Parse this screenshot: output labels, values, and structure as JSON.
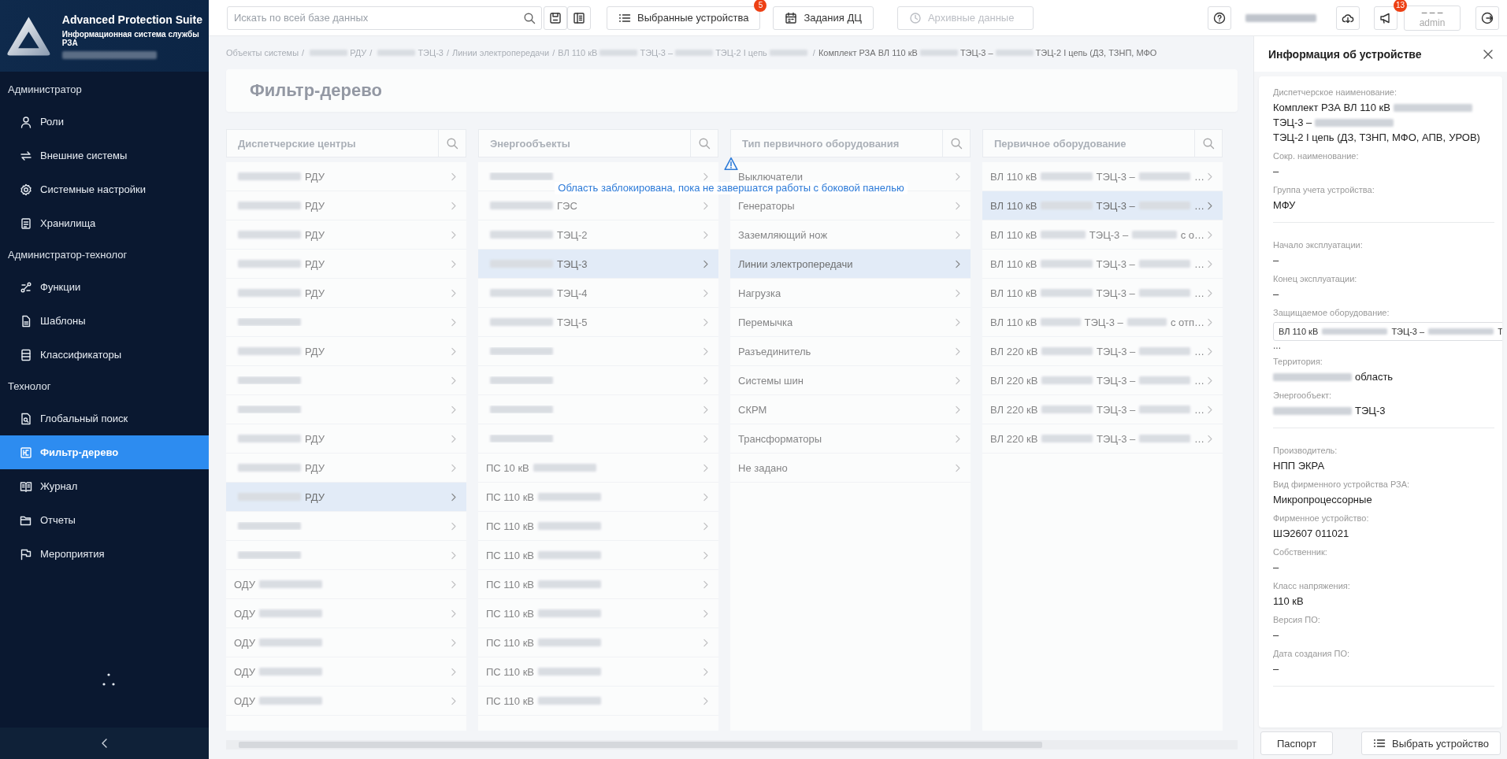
{
  "sidebar": {
    "app_title": "Advanced Protection Suite",
    "app_subtitle": "Информационная система службы РЗА",
    "sections": [
      {
        "title": "Администратор",
        "items": [
          {
            "label": "Роли",
            "selected": false
          },
          {
            "label": "Внешние системы",
            "selected": false
          },
          {
            "label": "Системные настройки",
            "selected": false
          },
          {
            "label": "Хранилища",
            "selected": false
          }
        ]
      },
      {
        "title": "Администратор-технолог",
        "items": [
          {
            "label": "Функции",
            "selected": false
          },
          {
            "label": "Шаблоны",
            "selected": false
          },
          {
            "label": "Классификаторы",
            "selected": false
          }
        ]
      },
      {
        "title": "Технолог",
        "items": [
          {
            "label": "Глобальный поиск",
            "selected": false
          },
          {
            "label": "Фильтр-дерево",
            "selected": true
          },
          {
            "label": "Журнал",
            "selected": false
          },
          {
            "label": "Отчеты",
            "selected": false
          },
          {
            "label": "Мероприятия",
            "selected": false
          }
        ]
      }
    ]
  },
  "toolbar": {
    "search": {
      "placeholder": "Искать по всей базе данных"
    },
    "buttons": [
      {
        "label": "Выбранные устройства",
        "badge": "5",
        "disabled": false
      },
      {
        "label": "Задания ДЦ",
        "disabled": false
      },
      {
        "label": "Архивные данные",
        "disabled": true
      }
    ],
    "notifications_badge": "13",
    "user": {
      "line1": "– – –",
      "line2": "admin"
    }
  },
  "main": {
    "locked": true,
    "locked_notice": "Область заблокирована, пока не завершатся работы с боковой панелью",
    "separator": "/",
    "breadcrumbs": [
      {
        "current": false,
        "parts": [
          {
            "kind": "text",
            "text": "Объекты системы"
          }
        ]
      },
      {
        "current": false,
        "parts": [
          {
            "kind": "blur"
          },
          {
            "kind": "text",
            "text": "РДУ"
          }
        ]
      },
      {
        "current": false,
        "parts": [
          {
            "kind": "blur"
          },
          {
            "kind": "text",
            "text": "ТЭЦ-3"
          }
        ]
      },
      {
        "current": false,
        "parts": [
          {
            "kind": "text",
            "text": "Линии электропередачи"
          }
        ]
      },
      {
        "current": false,
        "parts": [
          {
            "kind": "text",
            "text": "ВЛ 110 кВ"
          },
          {
            "kind": "blur"
          },
          {
            "kind": "text",
            "text": "ТЭЦ-3 –"
          },
          {
            "kind": "blur"
          },
          {
            "kind": "text",
            "text": "ТЭЦ-2 I цепь"
          },
          {
            "kind": "blur"
          }
        ]
      },
      {
        "current": true,
        "parts": [
          {
            "kind": "text",
            "text": "Комплект РЗА ВЛ 110 кВ"
          },
          {
            "kind": "blur"
          },
          {
            "kind": "text",
            "text": "ТЭЦ-3 –"
          },
          {
            "kind": "blur"
          },
          {
            "kind": "text",
            "text": "ТЭЦ-2 I цепь (ДЗ, ТЗНП, МФО"
          }
        ]
      }
    ],
    "title": "Фильтр-дерево",
    "columns": [
      {
        "placeholder": "Диспетчерские центры",
        "rows": [
          {
            "selected": false,
            "parts": [
              {
                "kind": "blur"
              },
              {
                "kind": "text",
                "text": "РДУ"
              }
            ]
          },
          {
            "selected": false,
            "parts": [
              {
                "kind": "blur"
              },
              {
                "kind": "text",
                "text": "РДУ"
              }
            ]
          },
          {
            "selected": false,
            "parts": [
              {
                "kind": "blur"
              },
              {
                "kind": "text",
                "text": "РДУ"
              }
            ]
          },
          {
            "selected": false,
            "parts": [
              {
                "kind": "blur"
              },
              {
                "kind": "text",
                "text": "РДУ"
              }
            ]
          },
          {
            "selected": false,
            "parts": [
              {
                "kind": "blur"
              },
              {
                "kind": "text",
                "text": "РДУ"
              }
            ]
          },
          {
            "selected": false,
            "parts": [
              {
                "kind": "blur"
              }
            ]
          },
          {
            "selected": false,
            "parts": [
              {
                "kind": "blur"
              },
              {
                "kind": "text",
                "text": "РДУ"
              }
            ]
          },
          {
            "selected": false,
            "parts": [
              {
                "kind": "blur"
              }
            ]
          },
          {
            "selected": false,
            "parts": [
              {
                "kind": "blur"
              }
            ]
          },
          {
            "selected": false,
            "parts": [
              {
                "kind": "blur"
              },
              {
                "kind": "text",
                "text": "РДУ"
              }
            ]
          },
          {
            "selected": false,
            "parts": [
              {
                "kind": "blur"
              },
              {
                "kind": "text",
                "text": "РДУ"
              }
            ]
          },
          {
            "selected": true,
            "parts": [
              {
                "kind": "blur"
              },
              {
                "kind": "text",
                "text": "РДУ"
              }
            ]
          },
          {
            "selected": false,
            "parts": [
              {
                "kind": "blur"
              }
            ]
          },
          {
            "selected": false,
            "parts": [
              {
                "kind": "blur"
              }
            ]
          },
          {
            "selected": false,
            "parts": [
              {
                "kind": "text",
                "text": "ОДУ"
              },
              {
                "kind": "blur"
              }
            ]
          },
          {
            "selected": false,
            "parts": [
              {
                "kind": "text",
                "text": "ОДУ"
              },
              {
                "kind": "blur"
              }
            ]
          },
          {
            "selected": false,
            "parts": [
              {
                "kind": "text",
                "text": "ОДУ"
              },
              {
                "kind": "blur"
              }
            ]
          },
          {
            "selected": false,
            "parts": [
              {
                "kind": "text",
                "text": "ОДУ"
              },
              {
                "kind": "blur"
              }
            ]
          },
          {
            "selected": false,
            "parts": [
              {
                "kind": "text",
                "text": "ОДУ"
              },
              {
                "kind": "blur"
              }
            ]
          }
        ]
      },
      {
        "placeholder": "Энергообъекты",
        "rows": [
          {
            "selected": false,
            "parts": [
              {
                "kind": "blur"
              }
            ]
          },
          {
            "selected": false,
            "parts": [
              {
                "kind": "blur"
              },
              {
                "kind": "text",
                "text": "ГЭС"
              }
            ]
          },
          {
            "selected": false,
            "parts": [
              {
                "kind": "blur"
              },
              {
                "kind": "text",
                "text": "ТЭЦ-2"
              }
            ]
          },
          {
            "selected": true,
            "parts": [
              {
                "kind": "blur"
              },
              {
                "kind": "text",
                "text": "ТЭЦ-3"
              }
            ]
          },
          {
            "selected": false,
            "parts": [
              {
                "kind": "blur"
              },
              {
                "kind": "text",
                "text": "ТЭЦ-4"
              }
            ]
          },
          {
            "selected": false,
            "parts": [
              {
                "kind": "blur"
              },
              {
                "kind": "text",
                "text": "ТЭЦ-5"
              }
            ]
          },
          {
            "selected": false,
            "parts": [
              {
                "kind": "blur"
              }
            ]
          },
          {
            "selected": false,
            "parts": [
              {
                "kind": "blur"
              }
            ]
          },
          {
            "selected": false,
            "parts": [
              {
                "kind": "blur"
              }
            ]
          },
          {
            "selected": false,
            "parts": [
              {
                "kind": "blur"
              }
            ]
          },
          {
            "selected": false,
            "parts": [
              {
                "kind": "text",
                "text": "ПС 10 кВ"
              },
              {
                "kind": "blur"
              }
            ]
          },
          {
            "selected": false,
            "parts": [
              {
                "kind": "text",
                "text": "ПС 110 кВ"
              },
              {
                "kind": "blur"
              }
            ]
          },
          {
            "selected": false,
            "parts": [
              {
                "kind": "text",
                "text": "ПС 110 кВ"
              },
              {
                "kind": "blur"
              }
            ]
          },
          {
            "selected": false,
            "parts": [
              {
                "kind": "text",
                "text": "ПС 110 кВ"
              },
              {
                "kind": "blur"
              }
            ]
          },
          {
            "selected": false,
            "parts": [
              {
                "kind": "text",
                "text": "ПС 110 кВ"
              },
              {
                "kind": "blur"
              }
            ]
          },
          {
            "selected": false,
            "parts": [
              {
                "kind": "text",
                "text": "ПС 110 кВ"
              },
              {
                "kind": "blur"
              }
            ]
          },
          {
            "selected": false,
            "parts": [
              {
                "kind": "text",
                "text": "ПС 110 кВ"
              },
              {
                "kind": "blur"
              }
            ]
          },
          {
            "selected": false,
            "parts": [
              {
                "kind": "text",
                "text": "ПС 110 кВ"
              },
              {
                "kind": "blur"
              }
            ]
          },
          {
            "selected": false,
            "parts": [
              {
                "kind": "text",
                "text": "ПС 110 кВ"
              },
              {
                "kind": "blur"
              }
            ]
          }
        ]
      },
      {
        "placeholder": "Тип первичного оборудования",
        "rows": [
          {
            "selected": false,
            "parts": [
              {
                "kind": "text",
                "text": "Выключатели"
              }
            ]
          },
          {
            "selected": false,
            "parts": [
              {
                "kind": "text",
                "text": "Генераторы"
              }
            ]
          },
          {
            "selected": false,
            "parts": [
              {
                "kind": "text",
                "text": "Заземляющий нож"
              }
            ]
          },
          {
            "selected": true,
            "parts": [
              {
                "kind": "text",
                "text": "Линии электропередачи"
              }
            ]
          },
          {
            "selected": false,
            "parts": [
              {
                "kind": "text",
                "text": "Нагрузка"
              }
            ]
          },
          {
            "selected": false,
            "parts": [
              {
                "kind": "text",
                "text": "Перемычка"
              }
            ]
          },
          {
            "selected": false,
            "parts": [
              {
                "kind": "text",
                "text": "Разъединитель"
              }
            ]
          },
          {
            "selected": false,
            "parts": [
              {
                "kind": "text",
                "text": "Системы шин"
              }
            ]
          },
          {
            "selected": false,
            "parts": [
              {
                "kind": "text",
                "text": "СКРМ"
              }
            ]
          },
          {
            "selected": false,
            "parts": [
              {
                "kind": "text",
                "text": "Трансформаторы"
              }
            ]
          },
          {
            "selected": false,
            "parts": [
              {
                "kind": "text",
                "text": "Не задано"
              }
            ]
          }
        ]
      },
      {
        "placeholder": "Первичное оборудование",
        "rows": [
          {
            "selected": false,
            "parts": [
              {
                "kind": "text",
                "text": "ВЛ 110 кВ"
              },
              {
                "kind": "blur"
              },
              {
                "kind": "text",
                "text": "ТЭЦ-3 –"
              },
              {
                "kind": "blur"
              },
              {
                "kind": "text",
                "text": "…"
              }
            ]
          },
          {
            "selected": true,
            "parts": [
              {
                "kind": "text",
                "text": "ВЛ 110 кВ"
              },
              {
                "kind": "blur"
              },
              {
                "kind": "text",
                "text": "ТЭЦ-3 –"
              },
              {
                "kind": "blur"
              },
              {
                "kind": "text",
                "text": "…"
              }
            ]
          },
          {
            "selected": false,
            "parts": [
              {
                "kind": "text",
                "text": "ВЛ 110 кВ"
              },
              {
                "kind": "blur"
              },
              {
                "kind": "text",
                "text": "ТЭЦ-3 –"
              },
              {
                "kind": "blur"
              },
              {
                "kind": "text",
                "text": "с о…"
              }
            ]
          },
          {
            "selected": false,
            "parts": [
              {
                "kind": "text",
                "text": "ВЛ 110 кВ"
              },
              {
                "kind": "blur"
              },
              {
                "kind": "text",
                "text": "ТЭЦ-3 –"
              },
              {
                "kind": "blur"
              },
              {
                "kind": "text",
                "text": "…"
              }
            ]
          },
          {
            "selected": false,
            "parts": [
              {
                "kind": "text",
                "text": "ВЛ 110 кВ"
              },
              {
                "kind": "blur"
              },
              {
                "kind": "text",
                "text": "ТЭЦ-3 –"
              },
              {
                "kind": "blur"
              },
              {
                "kind": "text",
                "text": "…"
              }
            ]
          },
          {
            "selected": false,
            "parts": [
              {
                "kind": "text",
                "text": "ВЛ 110 кВ"
              },
              {
                "kind": "blur"
              },
              {
                "kind": "text",
                "text": "ТЭЦ-3 –"
              },
              {
                "kind": "blur"
              },
              {
                "kind": "text",
                "text": "с отп…"
              }
            ]
          },
          {
            "selected": false,
            "parts": [
              {
                "kind": "text",
                "text": "ВЛ 220 кВ"
              },
              {
                "kind": "blur"
              },
              {
                "kind": "text",
                "text": "ТЭЦ-3 –"
              },
              {
                "kind": "blur"
              },
              {
                "kind": "text",
                "text": "…"
              }
            ]
          },
          {
            "selected": false,
            "parts": [
              {
                "kind": "text",
                "text": "ВЛ 220 кВ"
              },
              {
                "kind": "blur"
              },
              {
                "kind": "text",
                "text": "ТЭЦ-3 –"
              },
              {
                "kind": "blur"
              },
              {
                "kind": "text",
                "text": "…"
              }
            ]
          },
          {
            "selected": false,
            "parts": [
              {
                "kind": "text",
                "text": "ВЛ 220 кВ"
              },
              {
                "kind": "blur"
              },
              {
                "kind": "text",
                "text": "ТЭЦ-3 –"
              },
              {
                "kind": "blur"
              },
              {
                "kind": "text",
                "text": "…"
              }
            ]
          },
          {
            "selected": false,
            "parts": [
              {
                "kind": "text",
                "text": "ВЛ 220 кВ"
              },
              {
                "kind": "blur"
              },
              {
                "kind": "text",
                "text": "ТЭЦ-3 –"
              },
              {
                "kind": "blur"
              },
              {
                "kind": "text",
                "text": "…"
              }
            ]
          }
        ]
      }
    ]
  },
  "panel": {
    "title": "Информация об устройстве",
    "groups": [
      {
        "fields": [
          {
            "label": "Диспетчерское наименование:",
            "kind": "value",
            "parts": [
              {
                "kind": "text",
                "text": "Комплект РЗА ВЛ 110 кВ"
              },
              {
                "kind": "blur"
              },
              {
                "kind": "text",
                "text": "ТЭЦ-3 –"
              },
              {
                "kind": "blur"
              },
              {
                "kind": "text",
                "text": "ТЭЦ-2 I цепь (ДЗ, ТЗНП, МФО, АПВ,"
              },
              {
                "kind": "text",
                "text": "УРОВ)"
              }
            ]
          },
          {
            "label": "Сокр. наименование:",
            "kind": "value",
            "parts": [
              {
                "kind": "text",
                "text": "–"
              }
            ]
          },
          {
            "label": "Группа учета устройства:",
            "kind": "value",
            "parts": [
              {
                "kind": "text",
                "text": "МФУ"
              }
            ]
          }
        ]
      },
      {
        "fields": [
          {
            "label": "Начало эксплуатации:",
            "kind": "value",
            "parts": [
              {
                "kind": "text",
                "text": "–"
              }
            ]
          },
          {
            "label": "Конец эксплуатации:",
            "kind": "value",
            "parts": [
              {
                "kind": "text",
                "text": "–"
              }
            ]
          },
          {
            "label": "Защищаемое оборудование:",
            "kind": "tag",
            "more": "...",
            "parts": [
              {
                "kind": "text",
                "text": "ВЛ 110 кВ"
              },
              {
                "kind": "blur"
              },
              {
                "kind": "text",
                "text": "ТЭЦ-3 –"
              },
              {
                "kind": "blur"
              },
              {
                "kind": "text",
                "text": "Т"
              }
            ]
          },
          {
            "label": "Территория:",
            "kind": "value",
            "parts": [
              {
                "kind": "blur"
              },
              {
                "kind": "text",
                "text": "область"
              }
            ]
          },
          {
            "label": "Энергообъект:",
            "kind": "value",
            "parts": [
              {
                "kind": "blur"
              },
              {
                "kind": "text",
                "text": "ТЭЦ-3"
              }
            ]
          }
        ]
      },
      {
        "fields": [
          {
            "label": "Производитель:",
            "kind": "value",
            "parts": [
              {
                "kind": "text",
                "text": "НПП ЭКРА"
              }
            ]
          },
          {
            "label": "Вид фирменного устройства РЗА:",
            "kind": "value",
            "parts": [
              {
                "kind": "text",
                "text": "Микропроцессорные"
              }
            ]
          },
          {
            "label": "Фирменное устройство:",
            "kind": "value",
            "parts": [
              {
                "kind": "text",
                "text": "ШЭ2607 011021"
              }
            ]
          },
          {
            "label": "Собственник:",
            "kind": "value",
            "parts": [
              {
                "kind": "text",
                "text": "–"
              }
            ]
          },
          {
            "label": "Класс напряжения:",
            "kind": "value",
            "parts": [
              {
                "kind": "text",
                "text": "110 кВ"
              }
            ]
          },
          {
            "label": "Версия ПО:",
            "kind": "value",
            "parts": [
              {
                "kind": "text",
                "text": "–"
              }
            ]
          },
          {
            "label": "Дата создания ПО:",
            "kind": "value",
            "parts": [
              {
                "kind": "text",
                "text": "–"
              }
            ]
          }
        ]
      }
    ],
    "buttons": [
      "Паспорт",
      "Выбрать устройство"
    ]
  }
}
